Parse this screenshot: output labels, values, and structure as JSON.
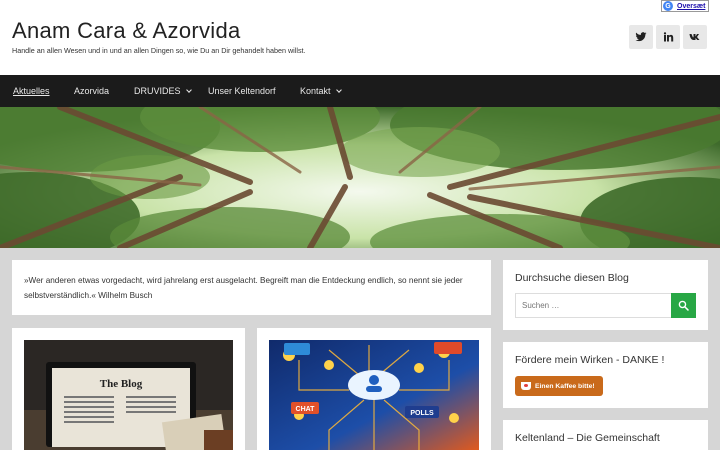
{
  "header": {
    "title": "Anam Cara & Azorvida",
    "tagline": "Handle an allen Wesen und in und an allen Dingen so, wie Du an Dir gehandelt haben willst.",
    "social": [
      "twitter-icon",
      "linkedin-icon",
      "vk-icon"
    ],
    "translate_label": "Oversæt"
  },
  "nav": {
    "items": [
      {
        "label": "Aktuelles",
        "active": true,
        "dropdown": false
      },
      {
        "label": "Azorvida",
        "active": false,
        "dropdown": false
      },
      {
        "label": "DRUVIDES",
        "active": false,
        "dropdown": true
      },
      {
        "label": "Unser Keltendorf",
        "active": false,
        "dropdown": false
      },
      {
        "label": "Kontakt",
        "active": false,
        "dropdown": true
      }
    ]
  },
  "quote": {
    "text": "»Wer anderen etwas vorgedacht, wird jahrelang erst ausgelacht. Begreift man die Entdeckung endlich, so nennt sie jeder selbstverständlich.« Wilhelm Busch"
  },
  "posts": [
    {
      "image_text": "The Blog"
    },
    {
      "image_labels": [
        "CHAT",
        "POLLS"
      ]
    }
  ],
  "sidebar": {
    "search": {
      "title": "Durchsuche diesen Blog",
      "placeholder": "Suchen …"
    },
    "coffee": {
      "title": "Fördere mein Wirken - DANKE !",
      "button": "Einen Kaffee bitte!"
    },
    "kelten": {
      "title": "Keltenland – Die Gemeinschaft"
    }
  },
  "colors": {
    "nav_bg": "#1b1b1b",
    "accent_green": "#28a745",
    "coffee_orange": "#c96a1b",
    "page_bg": "#d6d6d6"
  }
}
